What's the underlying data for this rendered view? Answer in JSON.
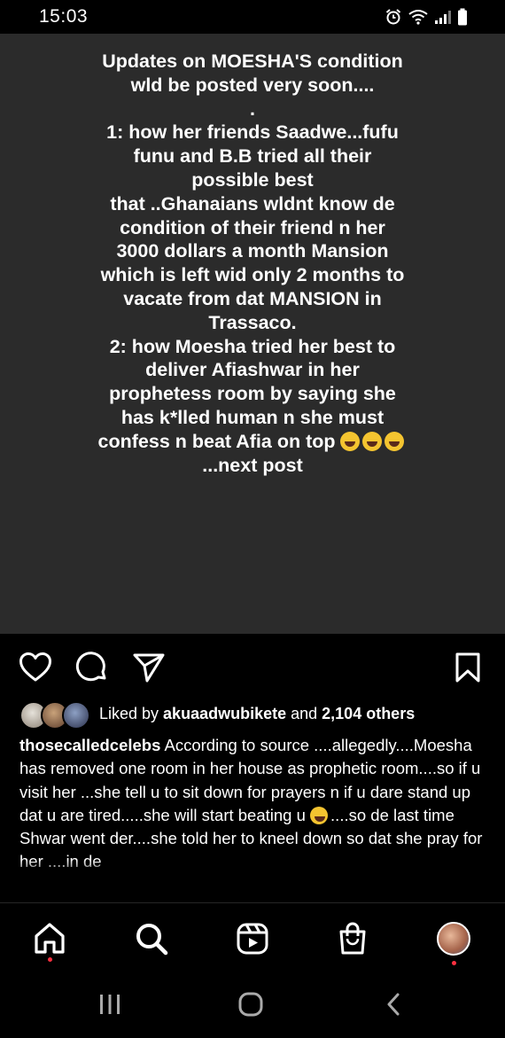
{
  "status_bar": {
    "time": "15:03",
    "icons": [
      "alarm-icon",
      "wifi-icon",
      "signal-icon",
      "battery-icon"
    ]
  },
  "post": {
    "text": "Updates on MOESHA'S condition wld be posted very soon....\n.\n1: how her friends Saadwe...fufu funu and B.B tried all their possible best\nthat ..Ghanaians wldnt know de condition of their friend n her 3000 dollars a month Mansion which is left wid only 2 months to vacate from dat MANSION in Trassaco.\n2: how Moesha tried her best to deliver Afiashwar in her prophetess room by saying she has k*lled human n she must confess n beat Afia on top",
    "text_tail": "...next post",
    "emoji": "grinning-squinting-face",
    "emoji_count": 3
  },
  "actions": {
    "like": "heart-icon",
    "comment": "comment-icon",
    "share": "send-icon",
    "save": "bookmark-icon"
  },
  "likes": {
    "prefix": "Liked by ",
    "user": "akuaadwubikete",
    "middle": " and ",
    "others": "2,104 others"
  },
  "caption": {
    "username": "thosecalledcelebs",
    "text": "According to source ....allegedly....Moesha has removed one room in her house as prophetic room....so if u visit her ...she tell u to sit down for prayers n if u dare stand up dat u are tired.....she will start beating u",
    "emoji": "winking-face",
    "text_after": "....so de last time Shwar went der....she told her to kneel down so dat she pray for her ....in de"
  },
  "bottom_nav": [
    "home-icon",
    "search-icon",
    "reels-icon",
    "shop-icon",
    "profile-avatar"
  ],
  "system_nav": [
    "recents-icon",
    "home-circle-icon",
    "back-icon"
  ],
  "colors": {
    "background": "#000000",
    "post_bg": "#2b2b2b",
    "notification_dot": "#ff3040"
  }
}
